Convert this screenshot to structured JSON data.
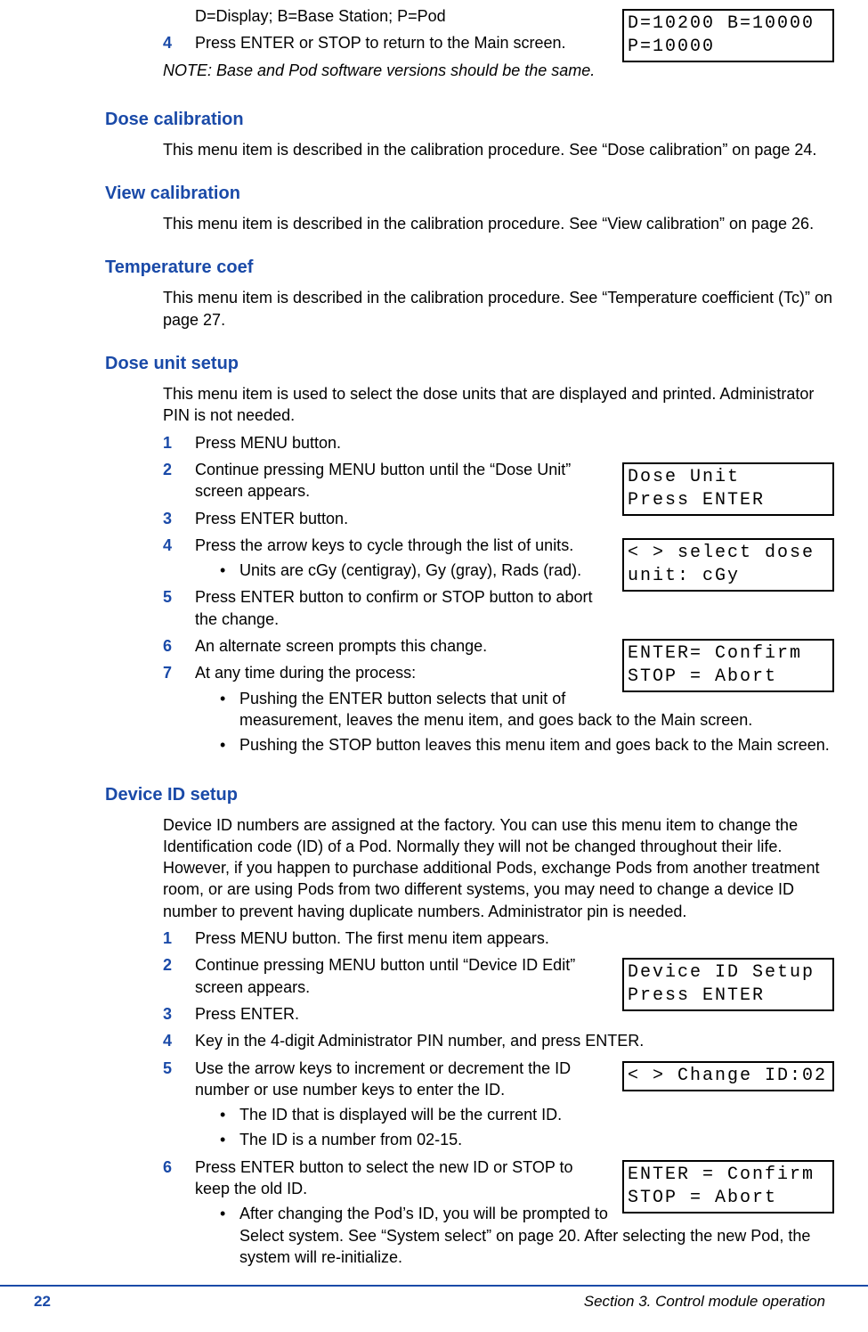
{
  "intro": {
    "legend": "D=Display; B=Base Station; P=Pod",
    "step4": "Press ENTER or STOP to return to the Main screen.",
    "note": "NOTE: Base and Pod software versions should be the same."
  },
  "lcd": {
    "versions_l1": "D=10200 B=10000",
    "versions_l2": "P=10000",
    "doseunit_l1": "Dose Unit",
    "doseunit_l2": "Press ENTER",
    "select_l1": "< > select dose",
    "select_l2": "unit: cGy",
    "confirm1_l1": "ENTER= Confirm",
    "confirm1_l2": "STOP = Abort",
    "devid_l1": "Device ID Setup",
    "devid_l2": "Press ENTER",
    "change_l1": "< > Change ID:02",
    "change_l2": "",
    "confirm2_l1": "ENTER = Confirm",
    "confirm2_l2": "STOP = Abort"
  },
  "sections": {
    "dose_cal": {
      "title": "Dose calibration",
      "body": "This menu item is described in the calibration procedure. See “Dose calibration” on page 24."
    },
    "view_cal": {
      "title": "View calibration",
      "body": "This menu item is described in the calibration procedure. See “View calibration” on page 26."
    },
    "temp_coef": {
      "title": "Temperature coef",
      "body": "This menu item is described in the calibration procedure. See “Temperature coefficient (Tc)” on page 27."
    },
    "dose_unit": {
      "title": "Dose unit setup",
      "intro": "This menu item is used to select the dose units that are displayed and printed. Administrator PIN is not needed.",
      "s1": "Press MENU button.",
      "s2": "Continue pressing MENU button until the “Dose Unit” screen appears.",
      "s3": "Press ENTER button.",
      "s4": "Press the arrow keys to cycle through the list of units.",
      "s4_b1": "Units are cGy (centigray), Gy (gray), Rads (rad).",
      "s5": "Press ENTER button to confirm or STOP button to abort the change.",
      "s6": "An alternate screen prompts this change.",
      "s7": "At any time during the process:",
      "s7_b1": "Pushing the ENTER button selects that unit of measurement, leaves the menu item, and goes back to the Main screen.",
      "s7_b2": "Pushing the STOP button leaves this menu item and goes back to the Main screen."
    },
    "device_id": {
      "title": "Device ID setup",
      "intro": "Device ID numbers are assigned at the factory. You can use this menu item to change the Identification code (ID) of a Pod. Normally they will not be changed throughout their life. However, if you happen to purchase additional Pods, exchange Pods from another treatment room, or are using Pods from two different systems, you may need to change a device ID number to prevent having duplicate numbers. Administrator pin is needed.",
      "s1": "Press MENU button. The first menu item appears.",
      "s2": "Continue pressing MENU button until “Device ID Edit” screen appears.",
      "s3": "Press ENTER.",
      "s4": "Key in the 4-digit Administrator PIN number, and press ENTER.",
      "s5": "Use the arrow keys to increment or decrement the ID number or use number keys to enter the ID.",
      "s5_b1": "The ID that is displayed will be the current ID.",
      "s5_b2": "The ID is a number from 02-15.",
      "s6": "Press ENTER button to select the new ID or STOP to keep the old ID.",
      "s6_b1": "After changing the Pod’s ID, you will be prompted to Select system. See “System select” on page 20. After selecting the new Pod, the system will re-initialize."
    }
  },
  "footer": {
    "page": "22",
    "section": "Section 3. Control module operation"
  }
}
